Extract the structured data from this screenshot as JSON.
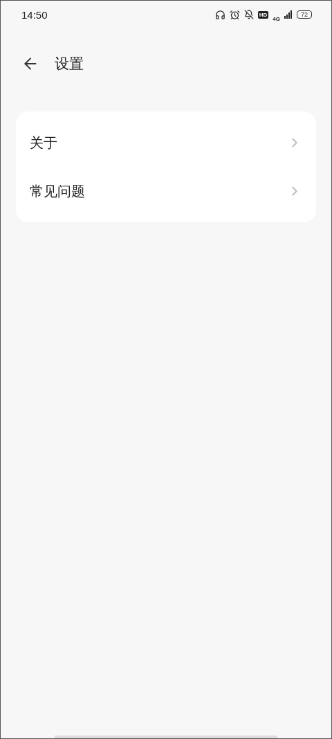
{
  "status_bar": {
    "time": "14:50",
    "hd": "HD",
    "network": "4G",
    "battery": "72"
  },
  "header": {
    "title": "设置"
  },
  "menu": [
    {
      "label": "关于"
    },
    {
      "label": "常见问题"
    }
  ]
}
